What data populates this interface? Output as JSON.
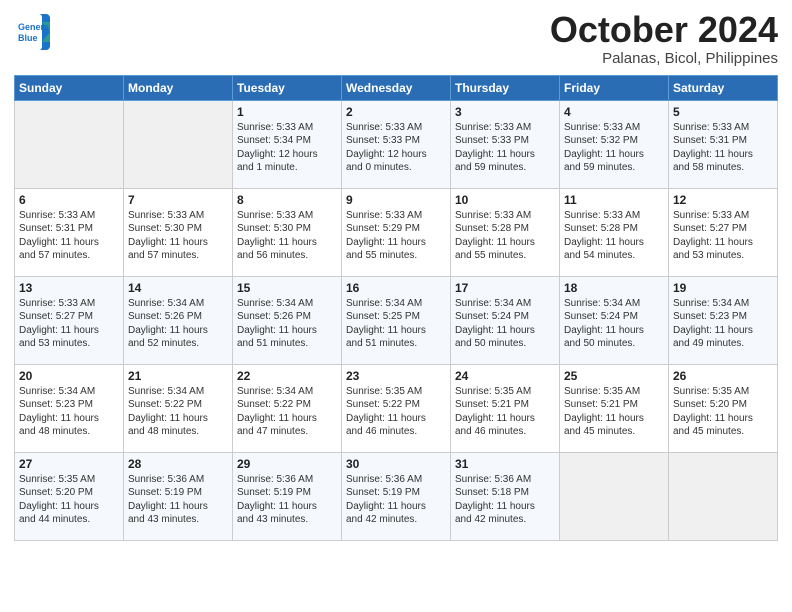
{
  "logo": {
    "line1": "General",
    "line2": "Blue"
  },
  "title": "October 2024",
  "subtitle": "Palanas, Bicol, Philippines",
  "days_of_week": [
    "Sunday",
    "Monday",
    "Tuesday",
    "Wednesday",
    "Thursday",
    "Friday",
    "Saturday"
  ],
  "weeks": [
    [
      {
        "day": "",
        "info": ""
      },
      {
        "day": "",
        "info": ""
      },
      {
        "day": "1",
        "info": "Sunrise: 5:33 AM\nSunset: 5:34 PM\nDaylight: 12 hours\nand 1 minute."
      },
      {
        "day": "2",
        "info": "Sunrise: 5:33 AM\nSunset: 5:33 PM\nDaylight: 12 hours\nand 0 minutes."
      },
      {
        "day": "3",
        "info": "Sunrise: 5:33 AM\nSunset: 5:33 PM\nDaylight: 11 hours\nand 59 minutes."
      },
      {
        "day": "4",
        "info": "Sunrise: 5:33 AM\nSunset: 5:32 PM\nDaylight: 11 hours\nand 59 minutes."
      },
      {
        "day": "5",
        "info": "Sunrise: 5:33 AM\nSunset: 5:31 PM\nDaylight: 11 hours\nand 58 minutes."
      }
    ],
    [
      {
        "day": "6",
        "info": "Sunrise: 5:33 AM\nSunset: 5:31 PM\nDaylight: 11 hours\nand 57 minutes."
      },
      {
        "day": "7",
        "info": "Sunrise: 5:33 AM\nSunset: 5:30 PM\nDaylight: 11 hours\nand 57 minutes."
      },
      {
        "day": "8",
        "info": "Sunrise: 5:33 AM\nSunset: 5:30 PM\nDaylight: 11 hours\nand 56 minutes."
      },
      {
        "day": "9",
        "info": "Sunrise: 5:33 AM\nSunset: 5:29 PM\nDaylight: 11 hours\nand 55 minutes."
      },
      {
        "day": "10",
        "info": "Sunrise: 5:33 AM\nSunset: 5:28 PM\nDaylight: 11 hours\nand 55 minutes."
      },
      {
        "day": "11",
        "info": "Sunrise: 5:33 AM\nSunset: 5:28 PM\nDaylight: 11 hours\nand 54 minutes."
      },
      {
        "day": "12",
        "info": "Sunrise: 5:33 AM\nSunset: 5:27 PM\nDaylight: 11 hours\nand 53 minutes."
      }
    ],
    [
      {
        "day": "13",
        "info": "Sunrise: 5:33 AM\nSunset: 5:27 PM\nDaylight: 11 hours\nand 53 minutes."
      },
      {
        "day": "14",
        "info": "Sunrise: 5:34 AM\nSunset: 5:26 PM\nDaylight: 11 hours\nand 52 minutes."
      },
      {
        "day": "15",
        "info": "Sunrise: 5:34 AM\nSunset: 5:26 PM\nDaylight: 11 hours\nand 51 minutes."
      },
      {
        "day": "16",
        "info": "Sunrise: 5:34 AM\nSunset: 5:25 PM\nDaylight: 11 hours\nand 51 minutes."
      },
      {
        "day": "17",
        "info": "Sunrise: 5:34 AM\nSunset: 5:24 PM\nDaylight: 11 hours\nand 50 minutes."
      },
      {
        "day": "18",
        "info": "Sunrise: 5:34 AM\nSunset: 5:24 PM\nDaylight: 11 hours\nand 50 minutes."
      },
      {
        "day": "19",
        "info": "Sunrise: 5:34 AM\nSunset: 5:23 PM\nDaylight: 11 hours\nand 49 minutes."
      }
    ],
    [
      {
        "day": "20",
        "info": "Sunrise: 5:34 AM\nSunset: 5:23 PM\nDaylight: 11 hours\nand 48 minutes."
      },
      {
        "day": "21",
        "info": "Sunrise: 5:34 AM\nSunset: 5:22 PM\nDaylight: 11 hours\nand 48 minutes."
      },
      {
        "day": "22",
        "info": "Sunrise: 5:34 AM\nSunset: 5:22 PM\nDaylight: 11 hours\nand 47 minutes."
      },
      {
        "day": "23",
        "info": "Sunrise: 5:35 AM\nSunset: 5:22 PM\nDaylight: 11 hours\nand 46 minutes."
      },
      {
        "day": "24",
        "info": "Sunrise: 5:35 AM\nSunset: 5:21 PM\nDaylight: 11 hours\nand 46 minutes."
      },
      {
        "day": "25",
        "info": "Sunrise: 5:35 AM\nSunset: 5:21 PM\nDaylight: 11 hours\nand 45 minutes."
      },
      {
        "day": "26",
        "info": "Sunrise: 5:35 AM\nSunset: 5:20 PM\nDaylight: 11 hours\nand 45 minutes."
      }
    ],
    [
      {
        "day": "27",
        "info": "Sunrise: 5:35 AM\nSunset: 5:20 PM\nDaylight: 11 hours\nand 44 minutes."
      },
      {
        "day": "28",
        "info": "Sunrise: 5:36 AM\nSunset: 5:19 PM\nDaylight: 11 hours\nand 43 minutes."
      },
      {
        "day": "29",
        "info": "Sunrise: 5:36 AM\nSunset: 5:19 PM\nDaylight: 11 hours\nand 43 minutes."
      },
      {
        "day": "30",
        "info": "Sunrise: 5:36 AM\nSunset: 5:19 PM\nDaylight: 11 hours\nand 42 minutes."
      },
      {
        "day": "31",
        "info": "Sunrise: 5:36 AM\nSunset: 5:18 PM\nDaylight: 11 hours\nand 42 minutes."
      },
      {
        "day": "",
        "info": ""
      },
      {
        "day": "",
        "info": ""
      }
    ]
  ]
}
